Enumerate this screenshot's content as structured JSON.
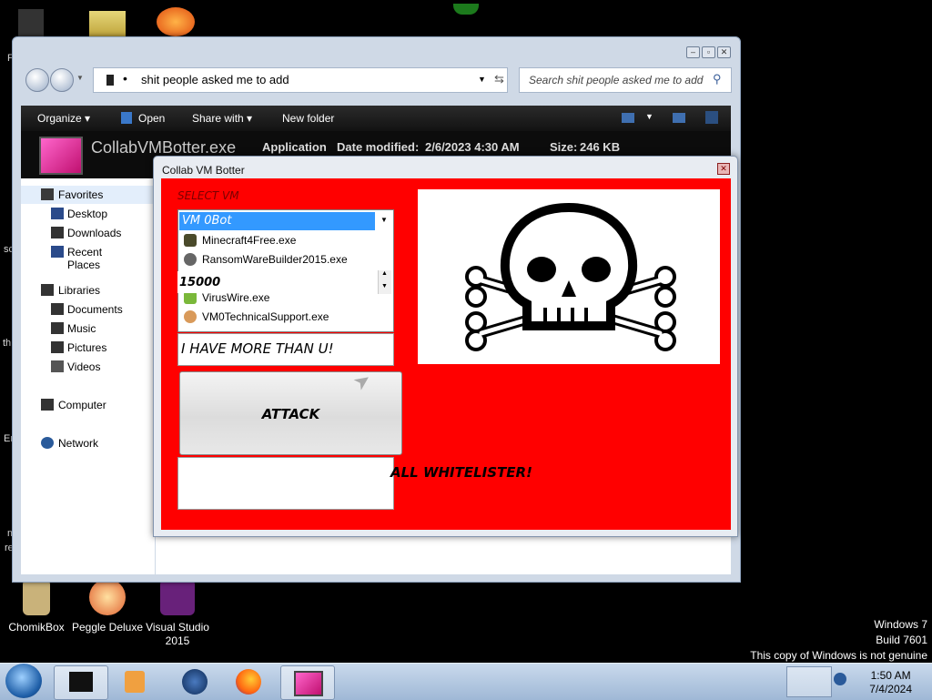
{
  "desktop": {
    "icons": [
      {
        "label": "ChomikBox"
      },
      {
        "label": "Peggle Deluxe"
      },
      {
        "label": "Visual Studio 2015"
      }
    ],
    "fragments": [
      "F",
      "sc",
      "th",
      "Er",
      "m",
      "re"
    ]
  },
  "explorer": {
    "address": "shit people asked me to add",
    "search_placeholder": "Search shit people asked me to add",
    "toolbar": {
      "organize": "Organize",
      "open": "Open",
      "share_with": "Share with",
      "new_folder": "New folder"
    },
    "details": {
      "filename": "CollabVMBotter.exe",
      "type": "Application",
      "date_label": "Date modified:",
      "date_value": "2/6/2023 4:30 AM",
      "size_label": "Size:",
      "size_value": "246 KB"
    },
    "nav": {
      "favorites": "Favorites",
      "desktop": "Desktop",
      "downloads": "Downloads",
      "recent_places": "Recent Places",
      "libraries": "Libraries",
      "documents": "Documents",
      "music": "Music",
      "pictures": "Pictures",
      "videos": "Videos",
      "computer": "Computer",
      "network": "Network"
    }
  },
  "dialog": {
    "title": "Collab VM Botter",
    "select_label": "SELECT VM",
    "selected_vm": "VM 0Bot",
    "list_items": [
      "Minecraft4Free.exe",
      "RansomWareBuilder2015.exe",
      "VirusWire.exe",
      "VM0TechnicalSupport.exe"
    ],
    "count_value": "15000",
    "message_value": "I HAVE MORE THAN U!",
    "attack_button": "ATTACK",
    "whitelister_text": "ALL WHITELISTER!"
  },
  "taskbar": {
    "time": "1:50 AM",
    "date": "7/4/2024"
  },
  "watermark": {
    "line1": "Windows 7",
    "line2": "Build 7601",
    "line3": "This copy of Windows is not genuine"
  },
  "colors": {
    "dialog_background": "#ff0000",
    "selection": "#3399ff",
    "taskbar": "#b5c9e2"
  }
}
